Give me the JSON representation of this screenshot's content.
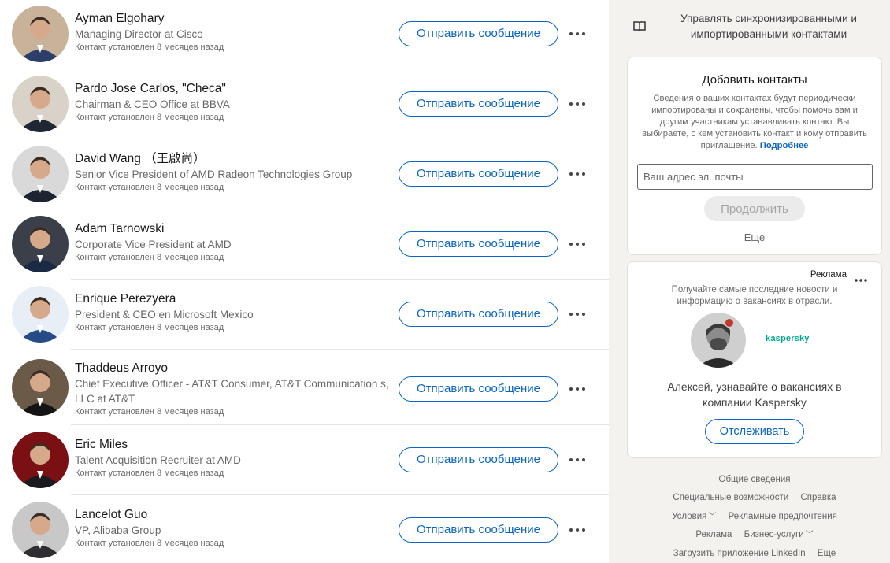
{
  "connections": [
    {
      "name": "Ayman Elgohary",
      "title": "Managing Director at Cisco",
      "connected": "Контакт установлен 8 месяцев назад",
      "message_label": "Отправить сообщение",
      "avatar_colors": [
        "#c9b29a",
        "#2c3e6a"
      ]
    },
    {
      "name": "Pardo Jose Carlos, \"Checa\"",
      "title": "Chairman & CEO Office at BBVA",
      "connected": "Контакт установлен 8 месяцев назад",
      "message_label": "Отправить сообщение",
      "avatar_colors": [
        "#d8d2c8",
        "#1f2733"
      ]
    },
    {
      "name": "David Wang （王啟尚）",
      "title": "Senior Vice President of AMD Radeon Technologies Group",
      "connected": "Контакт установлен 8 месяцев назад",
      "message_label": "Отправить сообщение",
      "avatar_colors": [
        "#d9d9d9",
        "#1d2431"
      ]
    },
    {
      "name": "Adam Tarnowski",
      "title": "Corporate Vice President at AMD",
      "connected": "Контакт установлен 8 месяцев назад",
      "message_label": "Отправить сообщение",
      "avatar_colors": [
        "#3a3f4a",
        "#1a2a44"
      ]
    },
    {
      "name": "Enrique Perezyera",
      "title": "President & CEO en Microsoft Mexico",
      "connected": "Контакт установлен 8 месяцев назад",
      "message_label": "Отправить сообщение",
      "avatar_colors": [
        "#e8eef5",
        "#274b86"
      ]
    },
    {
      "name": "Thaddeus Arroyo",
      "title": "Chief Executive Officer - AT&T Consumer, AT&T Communication s, LLC at AT&T",
      "connected": "Контакт установлен 8 месяцев назад",
      "message_label": "Отправить сообщение",
      "avatar_colors": [
        "#6c5a48",
        "#141414"
      ]
    },
    {
      "name": "Eric Miles",
      "title": "Talent Acquisition Recruiter at AMD",
      "connected": "Контакт установлен 8 месяцев назад",
      "message_label": "Отправить сообщение",
      "avatar_colors": [
        "#7a0f14",
        "#1b1b1f"
      ]
    },
    {
      "name": "Lancelot Guo",
      "title": "VP, Alibaba Group",
      "connected": "Контакт установлен 8 месяцев назад",
      "message_label": "Отправить сообщение",
      "avatar_colors": [
        "#c8c8c8",
        "#2e2e33"
      ]
    }
  ],
  "sidebar": {
    "manage_label": "Управлять синхронизированными и импортированными контактами",
    "add_contacts": {
      "title": "Добавить контакты",
      "description": "Сведения о ваших контактах будут периодически импортированы и сохранены, чтобы помочь вам и другим участникам устанавливать контакт. Вы выбираете, с кем установить контакт и кому отправить приглашение.",
      "learn_more": "Подробнее",
      "email_placeholder": "Ваш адрес эл. почты",
      "continue_label": "Продолжить",
      "more_label": "Еще"
    },
    "ad": {
      "label": "Реклама",
      "text": "Получайте самые последние новости и информацию о вакансиях в отрасли.",
      "logo": "kaspersky",
      "headline": "Алексей, узнавайте о вакансиях в компании Kaspersky",
      "follow_label": "Отслеживать"
    },
    "footer": {
      "about": "Общие сведения",
      "accessibility": "Специальные возможности",
      "help": "Справка",
      "terms": "Условия",
      "ad_prefs": "Рекламные предпочтения",
      "advertising": "Реклама",
      "business": "Бизнес-услуги",
      "get_app": "Загрузить приложение LinkedIn",
      "more": "Еще"
    }
  },
  "colors": {
    "accent": "#0a66c2",
    "kaspersky": "#00a88e",
    "page_bg": "#f3f2ef"
  }
}
